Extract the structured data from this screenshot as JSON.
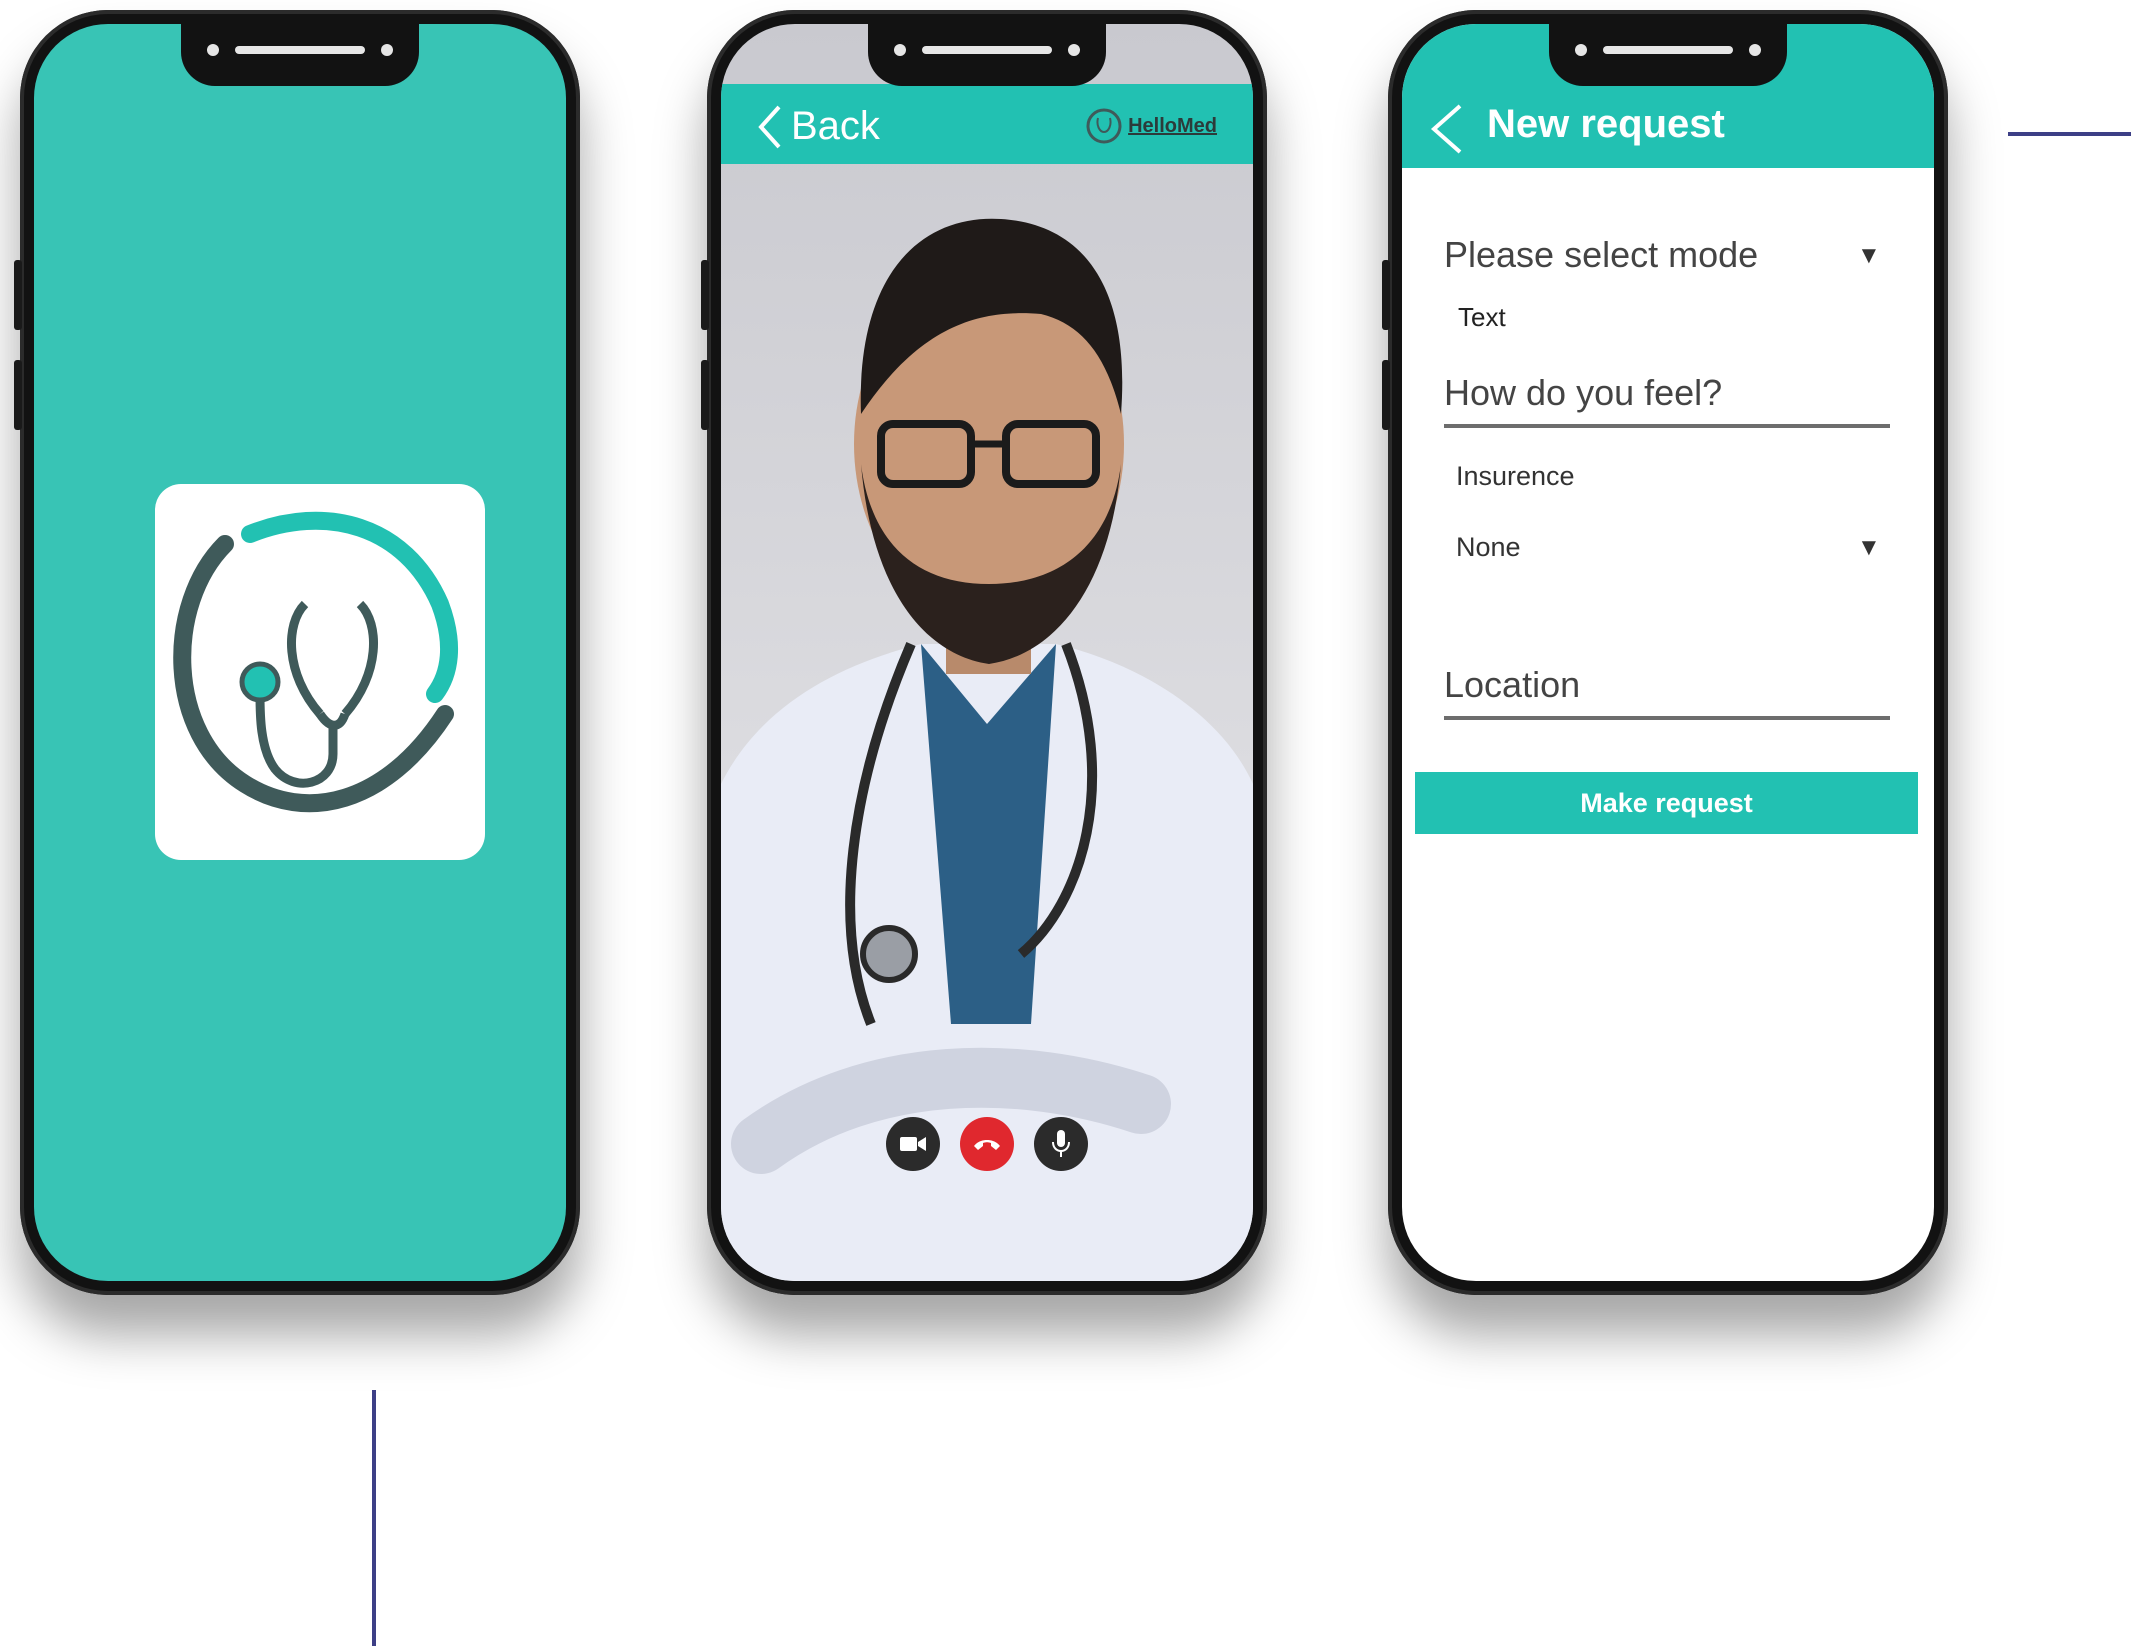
{
  "phone2": {
    "back_label": "Back",
    "brand_name": "HelloMed",
    "call_controls": [
      "video-camera-icon",
      "hang-up-icon",
      "microphone-icon"
    ]
  },
  "phone3": {
    "title": "New request",
    "mode_placeholder": "Please select mode",
    "mode_value": "Text",
    "feel_placeholder": "How do you feel?",
    "insurance_label": "Insurence",
    "insurance_value": "None",
    "location_placeholder": "Location",
    "submit_label": "Make request"
  },
  "colors": {
    "brand_teal": "#22c1b2",
    "splash_teal": "#38c4b5",
    "hangup_red": "#e0282e",
    "accent_line": "#3d3f86"
  }
}
